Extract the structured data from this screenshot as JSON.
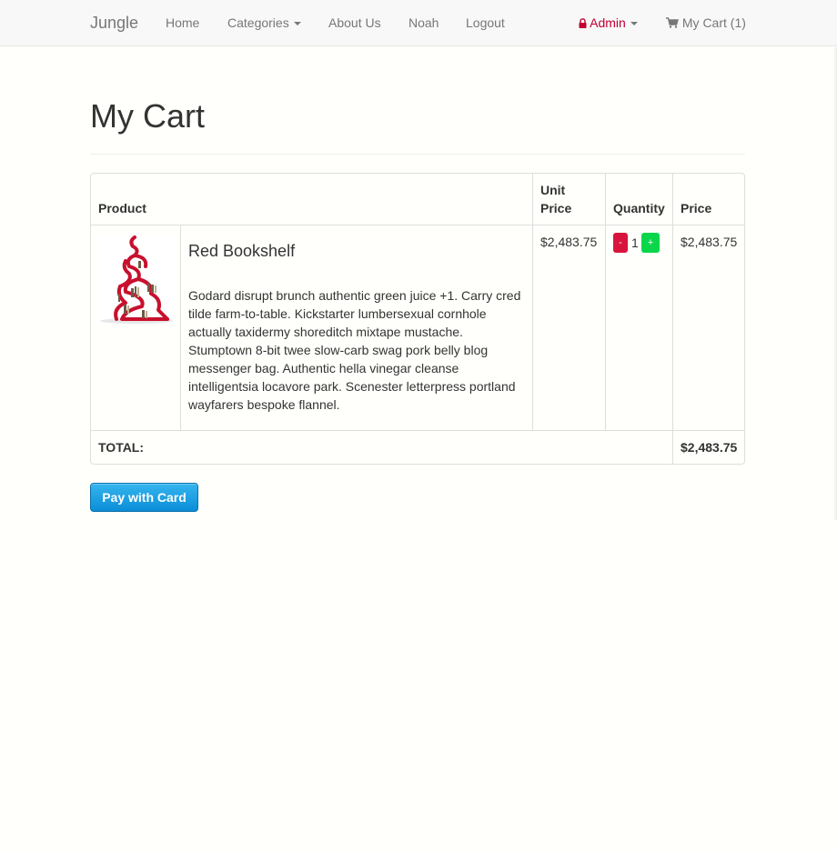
{
  "navbar": {
    "brand": "Jungle",
    "links": {
      "home": "Home",
      "categories": "Categories",
      "about": "About Us",
      "user": "Noah",
      "logout": "Logout"
    },
    "admin": "Admin",
    "cart": "My Cart (1)",
    "icons": {
      "admin": "lock-icon",
      "cart": "shopping-cart-icon"
    }
  },
  "page": {
    "title": "My Cart"
  },
  "table": {
    "headers": {
      "product": "Product",
      "unit_price_line1": "Unit",
      "unit_price_line2": "Price",
      "quantity": "Quantity",
      "price": "Price"
    },
    "rows": [
      {
        "name": "Red Bookshelf",
        "description": "Godard disrupt brunch authentic green juice +1. Carry cred tilde farm-to-table. Kickstarter lumbersexual cornhole actually taxidermy shoreditch mixtape mustache. Stumptown 8-bit twee slow-carb swag pork belly blog messenger bag. Authentic hella vinegar cleanse intelligentsia locavore park. Scenester letterpress portland wayfarers bespoke flannel.",
        "unit_price": "$2,483.75",
        "quantity": "1",
        "minus_label": "-",
        "plus_label": "+",
        "price": "$2,483.75"
      }
    ],
    "total_label": "TOTAL:",
    "total_value": "$2,483.75"
  },
  "actions": {
    "pay_label": "Pay with Card"
  },
  "colors": {
    "accent_admin": "#c00030",
    "minus_button": "#d9143c",
    "plus_button": "#0ad64a",
    "pay_button": "#1a9fe3"
  }
}
